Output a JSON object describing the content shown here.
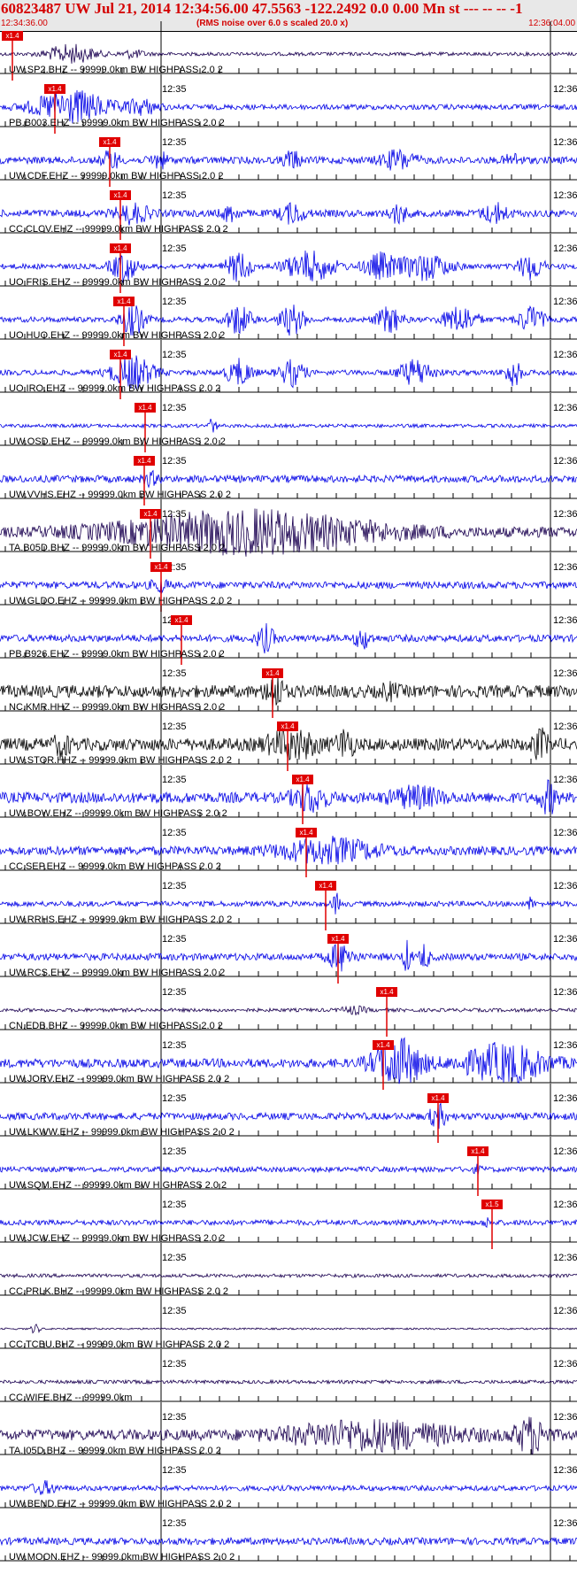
{
  "header": {
    "title": "60823487 UW Jul 21, 2014 12:34:56.00   47.5563 -122.2492  0.0 0.00 Mn st --- -- --  -1",
    "start_time": "12:34:36.00",
    "subtitle": "(RMS noise over 6.0 s scaled 20.0 x)",
    "end_time": "12:36:04.00"
  },
  "colors": {
    "header_text": "#d40000",
    "pick": "#e00000",
    "blue": "#0000e6",
    "dark": "#1a0050",
    "black": "#000000"
  },
  "traces": [
    {
      "label": "UW.SP2.BHZ -- 99999.0km BW  HIGHPASS  2.0  2",
      "tick_left": "",
      "tick_right": "",
      "pick_text": "x1.4",
      "color": "dark"
    },
    {
      "label": "PB.B003.EHZ -- 99999.0km BW  HIGHPASS  2.0  2",
      "tick_left": "12:35",
      "tick_right": "12:36",
      "pick_text": "x1.4",
      "color": "blue"
    },
    {
      "label": "UW.CDF.EHZ -- 99999.0km BW  HIGHPASS  2.0  2",
      "tick_left": "12:35",
      "tick_right": "12:36",
      "pick_text": "x1.4",
      "color": "blue"
    },
    {
      "label": "CC.CLCV.EHZ -- 99999.0km BW  HIGHPASS  2.0  2",
      "tick_left": "12:35",
      "tick_right": "12:36",
      "pick_text": "x1.4",
      "color": "blue"
    },
    {
      "label": "UO.FRIS.EHZ -- 99999.0km BW  HIGHPASS  2.0  2",
      "tick_left": "12:35",
      "tick_right": "12:36",
      "pick_text": "x1.4",
      "color": "blue"
    },
    {
      "label": "UO.HUO.EHZ -- 99999.0km BW  HIGHPASS  2.0  2",
      "tick_left": "12:35",
      "tick_right": "12:36",
      "pick_text": "x1.4",
      "color": "blue"
    },
    {
      "label": "UO.IRO.EHZ -- 99999.0km BW  HIGHPASS  2.0  2",
      "tick_left": "12:35",
      "tick_right": "12:36",
      "pick_text": "x1.4",
      "color": "blue"
    },
    {
      "label": "UW.OSD.EHZ -- 99999.0km BW  HIGHPASS  2.0  2",
      "tick_left": "12:35",
      "tick_right": "12:36",
      "pick_text": "x1.4",
      "color": "blue"
    },
    {
      "label": "UW.VVHS.EHZ -- 99999.0km BW  HIGHPASS  2.0  2",
      "tick_left": "12:35",
      "tick_right": "12:36",
      "pick_text": "x1.4",
      "color": "blue"
    },
    {
      "label": "TA.B05D.BHZ -- 99999.0km BW  HIGHPASS  2.0  2",
      "tick_left": "12:35",
      "tick_right": "12:36",
      "pick_text": "x1.4",
      "color": "dark"
    },
    {
      "label": "UW.GLDO.EHZ -- 99999.0km BW  HIGHPASS  2.0  2",
      "tick_left": "12:35",
      "tick_right": "12:36",
      "pick_text": "x1.4",
      "color": "blue"
    },
    {
      "label": "PB.B926.EHZ -- 99999.0km BW  HIGHPASS  2.0  2",
      "tick_left": "12:35",
      "tick_right": "12:36",
      "pick_text": "x1.4",
      "color": "blue"
    },
    {
      "label": "NC.KMR.HHZ -- 99999.0km BW  HIGHPASS  2.0  2",
      "tick_left": "12:35",
      "tick_right": "12:36",
      "pick_text": "x1.4",
      "color": "black"
    },
    {
      "label": "UW.STOR.HHZ -- 99999.0km BW  HIGHPASS  2.0  2",
      "tick_left": "12:35",
      "tick_right": "12:36",
      "pick_text": "x1.4",
      "color": "black"
    },
    {
      "label": "UW.BOW.EHZ -- 99999.0km BW  HIGHPASS  2.0  2",
      "tick_left": "12:35",
      "tick_right": "12:36",
      "pick_text": "x1.4",
      "color": "blue"
    },
    {
      "label": "CC.SEP.EHZ -- 99999.0km BW  HIGHPASS  2.0  2",
      "tick_left": "12:35",
      "tick_right": "12:36",
      "pick_text": "x1.4",
      "color": "blue"
    },
    {
      "label": "UW.RRHS.EHZ -- 99999.0km BW  HIGHPASS  2.0  2",
      "tick_left": "12:35",
      "tick_right": "12:36",
      "pick_text": "x1.4",
      "color": "blue"
    },
    {
      "label": "UW.RCS.EHZ -- 99999.0km BW  HIGHPASS  2.0  2",
      "tick_left": "12:35",
      "tick_right": "12:36",
      "pick_text": "x1.4",
      "color": "blue"
    },
    {
      "label": "CN.EDB.BHZ -- 99999.0km BW  HIGHPASS  2.0  2",
      "tick_left": "12:35",
      "tick_right": "12:36",
      "pick_text": "x1.4",
      "color": "dark"
    },
    {
      "label": "UW.JORV.EHZ -- 99999.0km BW  HIGHPASS  2.0  2",
      "tick_left": "12:35",
      "tick_right": "12:36",
      "pick_text": "x1.4",
      "color": "blue"
    },
    {
      "label": "UW.LKWW.EHZ -- 99999.0km BW  HIGHPASS  2.0  2",
      "tick_left": "12:35",
      "tick_right": "12:36",
      "pick_text": "x1.4",
      "color": "blue"
    },
    {
      "label": "UW.SQM.EHZ -- 99999.0km BW  HIGHPASS  2.0  2",
      "tick_left": "12:35",
      "tick_right": "12:36",
      "pick_text": "x1.4",
      "color": "blue"
    },
    {
      "label": "UW.JCW.EHZ -- 99999.0km BW  HIGHPASS  2.0  2",
      "tick_left": "12:35",
      "tick_right": "12:36",
      "pick_text": "x1.5",
      "color": "blue"
    },
    {
      "label": "CC.PRLK.BHZ -- 99999.0km BW  HIGHPASS  2.0  2",
      "tick_left": "12:35",
      "tick_right": "12:36",
      "pick_text": "",
      "color": "dark"
    },
    {
      "label": "CC.TCBU.BHZ -- 99999.0km BW  HIGHPASS  2.0  2",
      "tick_left": "12:35",
      "tick_right": "12:36",
      "pick_text": "",
      "color": "dark"
    },
    {
      "label": "CC.WIFE.BHZ -- 99999.0km",
      "tick_left": "12:35",
      "tick_right": "12:36",
      "pick_text": "",
      "color": "dark"
    },
    {
      "label": "TA.I05D.BHZ -- 99999.0km BW  HIGHPASS  2.0  2",
      "tick_left": "12:35",
      "tick_right": "12:36",
      "pick_text": "",
      "color": "dark"
    },
    {
      "label": "UW.BEND.EHZ -- 99999.0km BW  HIGHPASS  2.0  2",
      "tick_left": "12:35",
      "tick_right": "12:36",
      "pick_text": "",
      "color": "blue"
    },
    {
      "label": "UW.MOON.EHZ -- 99999.0km BW  HIGHPASS  2.0  2",
      "tick_left": "12:35",
      "tick_right": "12:36",
      "pick_text": "",
      "color": "blue"
    }
  ]
}
